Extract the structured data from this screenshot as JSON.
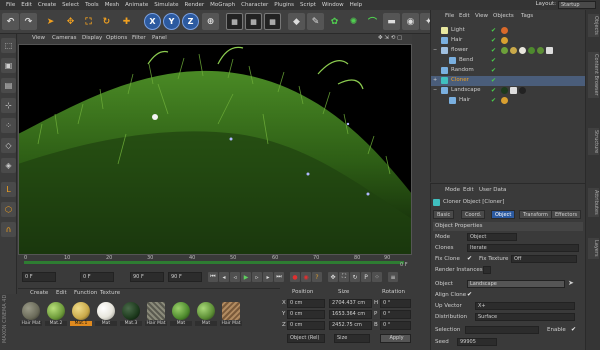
{
  "menubar": {
    "items": [
      "File",
      "Edit",
      "Create",
      "Select",
      "Tools",
      "Mesh",
      "Animate",
      "Simulate",
      "Render",
      "MoGraph",
      "Character",
      "Plugins",
      "Script",
      "Window",
      "Help"
    ],
    "layout_label": "Layout:",
    "layout_value": "Startup"
  },
  "toolbar": {
    "axis_x": "X",
    "axis_y": "Y",
    "axis_z": "Z"
  },
  "viewport": {
    "menu": [
      "View",
      "Cameras",
      "Display",
      "Options",
      "Filter",
      "Panel"
    ]
  },
  "timeline": {
    "ticks": [
      "0",
      "10",
      "20",
      "30",
      "40",
      "50",
      "60",
      "70",
      "80",
      "90"
    ],
    "end_tick": "0 F"
  },
  "playbar": {
    "start": "0 F",
    "current": "0 F",
    "end": "90 F",
    "end2": "90 F"
  },
  "materials": {
    "menu": [
      "Create",
      "Edit",
      "Function",
      "Texture"
    ],
    "items": [
      {
        "label": "Hair Mat",
        "color": "#6b6b5a"
      },
      {
        "label": "Mat.2",
        "color": "#6d9a3a"
      },
      {
        "label": "Mat.1",
        "color": "#c9a94a",
        "selected": true
      },
      {
        "label": "Mat",
        "color": "#e8e6dd"
      },
      {
        "label": "Mat.3",
        "color": "#1d3a1d"
      },
      {
        "label": "Hair Mat",
        "color": "#5a5a50"
      },
      {
        "label": "Mat",
        "color": "#4e8a2e"
      },
      {
        "label": "Mat",
        "color": "#5c8e35"
      },
      {
        "label": "Hair Mat",
        "color": "#7a5a3a"
      }
    ],
    "brand": "MAXON CINEMA 4D"
  },
  "coords": {
    "headers": [
      "Position",
      "Size",
      "Rotation"
    ],
    "rows": [
      {
        "axis": "X",
        "pos": "0 cm",
        "size": "2704.437 cm",
        "rotlabel": "H",
        "rot": "0 °"
      },
      {
        "axis": "Y",
        "pos": "0 cm",
        "size": "1653.364 cm",
        "rotlabel": "P",
        "rot": "0 °"
      },
      {
        "axis": "Z",
        "pos": "0 cm",
        "size": "2452.75 cm",
        "rotlabel": "B",
        "rot": "0 °"
      }
    ],
    "mode": "Object (Rel)",
    "size_mode": "Size",
    "apply": "Apply"
  },
  "objects": {
    "menu": [
      "File",
      "Edit",
      "View",
      "Objects",
      "Tags"
    ],
    "rows": [
      {
        "name": "Light",
        "indent": 0,
        "icon": "#e8e8a0"
      },
      {
        "name": "Hair",
        "indent": 0,
        "icon": "#7ab0e0"
      },
      {
        "name": "flower",
        "indent": 0,
        "icon": "#a0c0e0"
      },
      {
        "name": "Bend",
        "indent": 1,
        "icon": "#7ab0e0"
      },
      {
        "name": "Random",
        "indent": 0,
        "icon": "#7ab0e0"
      },
      {
        "name": "Cloner",
        "indent": 0,
        "icon": "#40c0c0"
      },
      {
        "name": "Landscape",
        "indent": 0,
        "icon": "#7ab0e0"
      },
      {
        "name": "Hair",
        "indent": 1,
        "icon": "#7ab0e0"
      }
    ]
  },
  "attributes": {
    "menu": [
      "Mode",
      "Edit",
      "User Data"
    ],
    "title": "Cloner Object [Cloner]",
    "tabs": [
      "Basic",
      "Coord.",
      "Object",
      "Transform",
      "Effectors"
    ],
    "active_tab": "Object",
    "section": "Object Properties",
    "fields": {
      "mode_label": "Mode",
      "mode_value": "Object",
      "clones_label": "Clones",
      "clones_value": "Iterate",
      "fix_clone_label": "Fix Clone",
      "fix_texture_label": "Fix Texture",
      "fix_texture_value": "Off",
      "render_instances_label": "Render Instances",
      "object_label": "Object",
      "object_value": "Landscape",
      "align_clone_label": "Align Clone",
      "up_vector_label": "Up Vector",
      "up_vector_value": "X+",
      "distribution_label": "Distribution",
      "distribution_value": "Surface",
      "selection_label": "Selection",
      "enable_label": "Enable",
      "seed_label": "Seed",
      "seed_value": "99905"
    }
  },
  "right_strip": [
    "Objects",
    "Content Browser",
    "Structure",
    "Attributes",
    "Layers"
  ]
}
